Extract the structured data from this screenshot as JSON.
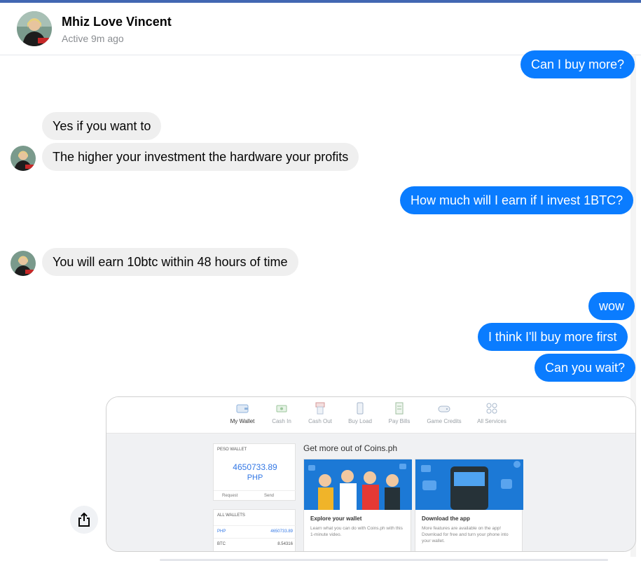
{
  "header": {
    "name": "Mhiz Love Vincent",
    "status": "Active 9m ago"
  },
  "messages": [
    {
      "from": "me",
      "text": "Can I buy more?"
    },
    {
      "from": "them",
      "text": "Yes if you want to"
    },
    {
      "from": "them",
      "text": "The higher your investment the hardware your profits"
    },
    {
      "from": "me",
      "text": "How much will I earn if I invest 1BTC?"
    },
    {
      "from": "them",
      "text": "You will earn 10btc within 48 hours of time"
    },
    {
      "from": "me",
      "text": "wow"
    },
    {
      "from": "me",
      "text": "I think I'll buy more first"
    },
    {
      "from": "me",
      "text": "Can you wait?"
    }
  ],
  "attachment": {
    "nav": [
      "My Wallet",
      "Cash In",
      "Cash Out",
      "Buy Load",
      "Pay Bills",
      "Game Credits",
      "All Services"
    ],
    "wallet_title": "PESO WALLET",
    "wallet_amount": "4650733.89",
    "wallet_currency": "PHP",
    "request_label": "Request",
    "send_label": "Send",
    "all_wallets_title": "ALL WALLETS",
    "wallets": [
      {
        "name": "PHP",
        "value": "4650733.89"
      },
      {
        "name": "BTC",
        "value": "8.54316"
      }
    ],
    "promo_heading": "Get more out of Coins.ph",
    "promos": [
      {
        "title": "Explore your wallet",
        "desc": "Learn what you can do with Coins.ph with this 1-minute video."
      },
      {
        "title": "Download the app",
        "desc": "More features are available on the app! Download for free and turn your phone into your wallet."
      }
    ]
  },
  "colors": {
    "outgoing": "#0a7cff",
    "incoming": "#efefef",
    "brand_stripe": "#4267b2"
  },
  "icons": {
    "share": "share-icon"
  }
}
